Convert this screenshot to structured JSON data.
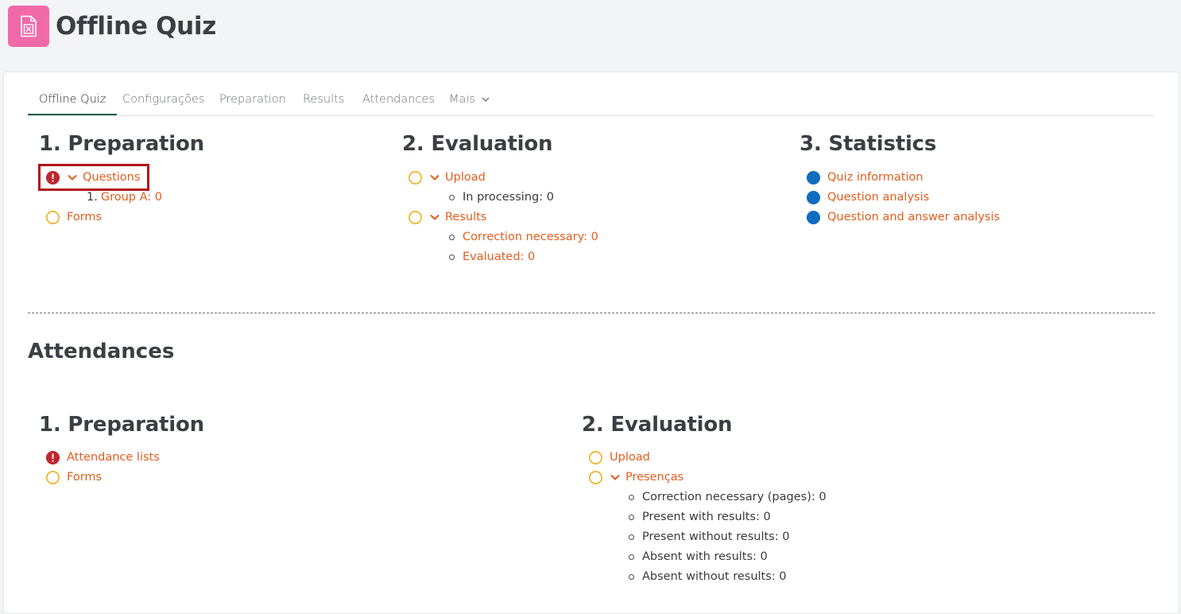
{
  "header": {
    "title": "Offline Quiz",
    "icon": "quiz-document-icon",
    "icon_color": "#f06aa8"
  },
  "tabs": [
    {
      "label": "Offline Quiz",
      "active": true
    },
    {
      "label": "Configurações"
    },
    {
      "label": "Preparation"
    },
    {
      "label": "Results"
    },
    {
      "label": "Attendances"
    },
    {
      "label": "Mais"
    }
  ],
  "quiz": {
    "preparation": {
      "title": "1. Preparation",
      "questions": {
        "label": "Questions",
        "status": "error"
      },
      "groups": [
        {
          "number": "1.",
          "label": "Group A: 0"
        }
      ],
      "forms": {
        "label": "Forms",
        "status": "pending"
      }
    },
    "evaluation": {
      "title": "2. Evaluation",
      "upload": {
        "label": "Upload",
        "status": "pending"
      },
      "in_processing": "In processing: 0",
      "results": {
        "label": "Results",
        "status": "pending"
      },
      "correction": "Correction necessary: 0",
      "evaluated": "Evaluated: 0"
    },
    "statistics": {
      "title": "3. Statistics",
      "items": [
        "Quiz information",
        "Question analysis",
        "Question and answer analysis"
      ]
    }
  },
  "attendances": {
    "title": "Attendances",
    "preparation": {
      "title": "1. Preparation",
      "lists": {
        "label": "Attendance lists",
        "status": "error"
      },
      "forms": {
        "label": "Forms",
        "status": "pending"
      }
    },
    "evaluation": {
      "title": "2. Evaluation",
      "upload": {
        "label": "Upload",
        "status": "pending"
      },
      "presencas": {
        "label": "Presenças",
        "status": "pending"
      },
      "items": [
        "Correction necessary (pages): 0",
        "Present with results: 0",
        "Present without results: 0",
        "Absent with results: 0",
        "Absent without results: 0"
      ]
    }
  },
  "colors": {
    "link": "#e35d1d",
    "error": "#c0262d",
    "pending": "#f0b429",
    "done": "#0f6cbf"
  }
}
